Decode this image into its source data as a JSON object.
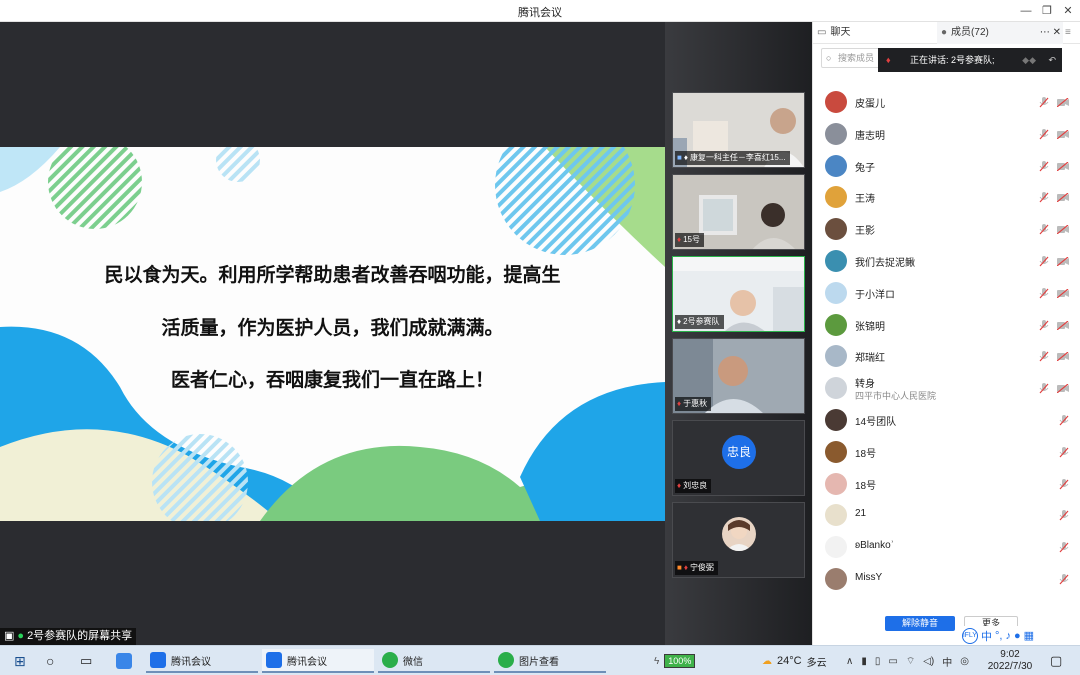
{
  "window": {
    "title": "腾讯会议"
  },
  "slide": {
    "lines": [
      "民以食为天。利用所学帮助患者改善吞咽功能，提高生",
      "活质量，作为医护人员，我们成就满满。",
      "医者仁心，吞咽康复我们一直在路上！"
    ]
  },
  "share_label": "2号参赛队的屏幕共享",
  "videos": [
    {
      "name": "康复一科主任－李喜红15..."
    },
    {
      "name": "15号"
    },
    {
      "name": "2号参赛队"
    },
    {
      "name": "于惠秋"
    },
    {
      "name": "刘忠良",
      "avatar_text": "忠良"
    },
    {
      "name": "宁俊弼"
    }
  ],
  "panel": {
    "tab_chat": "聊天",
    "tab_members": "成员(72)",
    "search_placeholder": "搜索成员",
    "speaking": "正在讲话: 2号参赛队;",
    "members": [
      {
        "name": "皮蛋儿",
        "color": "#c94a3e"
      },
      {
        "name": "唐志明",
        "color": "#8a8f9a"
      },
      {
        "name": "兔子",
        "color": "#4b86c4"
      },
      {
        "name": "王涛",
        "color": "#e0a23a"
      },
      {
        "name": "王影",
        "color": "#6b4f3e"
      },
      {
        "name": "我们去捉泥鳅",
        "color": "#3a8fb0"
      },
      {
        "name": "于小洋ロ",
        "color": "#bcd9ee"
      },
      {
        "name": "张锦明",
        "color": "#5c9a3e"
      },
      {
        "name": "郑瑞红",
        "color": "#a8b8c8"
      },
      {
        "name": "转身",
        "sub": "四平市中心人民医院",
        "color": "#cfd4da"
      },
      {
        "name": "14号团队",
        "color": "#4a3a34"
      },
      {
        "name": "18号",
        "color": "#8a5a2e"
      },
      {
        "name": "18号",
        "color": "#e5b7b0"
      },
      {
        "name": "21",
        "color": "#e8e0cc"
      },
      {
        "name": "ʚBlankoʾ",
        "color": "#f2f2f2"
      },
      {
        "name": "MissY",
        "color": "#9a7d6e"
      }
    ],
    "unmute_all": "解除静音",
    "more": "更多"
  },
  "taskbar": {
    "apps": [
      {
        "label": "腾讯会议",
        "color": "#1e6fe8"
      },
      {
        "label": "腾讯会议",
        "color": "#1e6fe8"
      },
      {
        "label": "微信",
        "color": "#2aae4a"
      },
      {
        "label": "图片查看",
        "color": "#2aae4a"
      }
    ],
    "battery": "100%",
    "weather_temp": "24°C",
    "weather_desc": "多云",
    "ime": "中",
    "time": "9:02",
    "date": "2022/7/30"
  }
}
